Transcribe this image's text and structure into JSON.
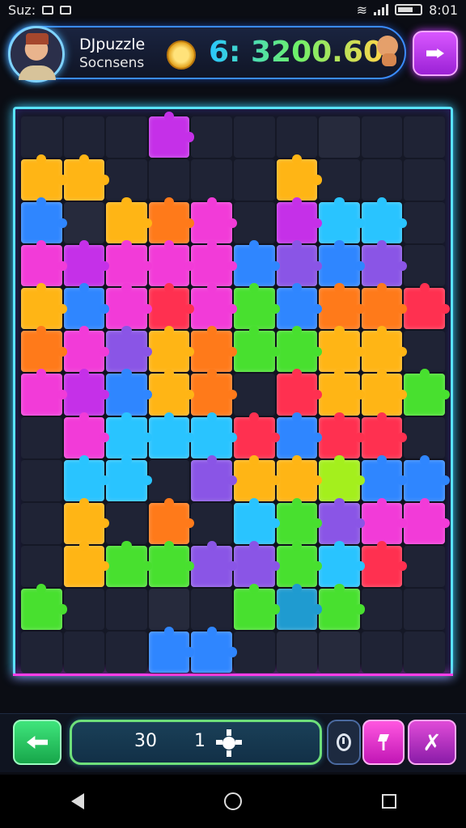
{
  "status": {
    "left_text": "Suz:",
    "time": "8:01"
  },
  "header": {
    "title": "DJpuzzle",
    "subtitle": "Socnsens",
    "score": "6: 3200.60"
  },
  "controls": {
    "count_left": "30",
    "count_right": "1"
  },
  "board": {
    "columns": 10,
    "colors": {
      "Y": "#ffb515",
      "O": "#ff7a1a",
      "P": "#f23bd8",
      "M": "#c530e8",
      "C": "#29c4ff",
      "B": "#2f86ff",
      "R": "#ff3050",
      "G": "#48e02f",
      "L": "#a4ef1d",
      "V": "#8a55e6",
      "K": "#1f2335",
      "D": "#262a3c",
      "T": "#1f9bd0",
      "W": "#f04040"
    },
    "rows": [
      "KKKMKKKDKK",
      "YYKKKKYKKK",
      "BDYOPKMCCK",
      "PMPPPBVBVK",
      "YBPRPGBOOR",
      "OPVYOGGYYK",
      "PMBYOKRYYG",
      "KPCCCRBRRK",
      "KCCKVYYLBB",
      "KYKOKCGVPP",
      "KYGGVVGCRK",
      "GKKDKGTGKK",
      "KKKBBKDDKK"
    ]
  }
}
